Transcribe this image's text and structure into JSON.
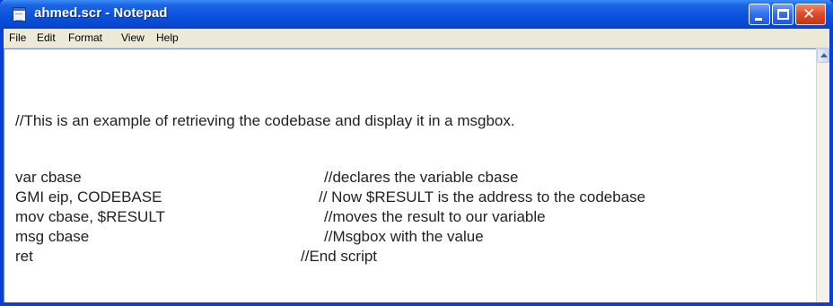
{
  "window": {
    "title": "ahmed.scr - Notepad"
  },
  "menu": {
    "file": "File",
    "edit": "Edit",
    "format": "Format",
    "view": "View",
    "help": "Help"
  },
  "editor": {
    "intro": "//This is an example of retrieving the codebase and display it in a msgbox.",
    "lines": [
      {
        "code": "var cbase",
        "comment": "//declares the variable cbase"
      },
      {
        "code": "GMI eip, CODEBASE",
        "comment": "// Now $RESULT is the address to the codebase"
      },
      {
        "code": "mov cbase, $RESULT",
        "comment": "//moves the result to our variable"
      },
      {
        "code": "msg cbase",
        "comment": "//Msgbox with the value"
      },
      {
        "code": "ret",
        "comment": "//End script"
      }
    ]
  },
  "icons": {
    "app": "notepad-icon",
    "minimize": "minimize-icon",
    "maximize": "maximize-icon",
    "close": "close-icon",
    "scroll_up": "scroll-up-arrow-icon"
  },
  "colors": {
    "titlebar": "#0a52dc",
    "menubar": "#ece9d8",
    "close_button": "#dd4a2a"
  }
}
